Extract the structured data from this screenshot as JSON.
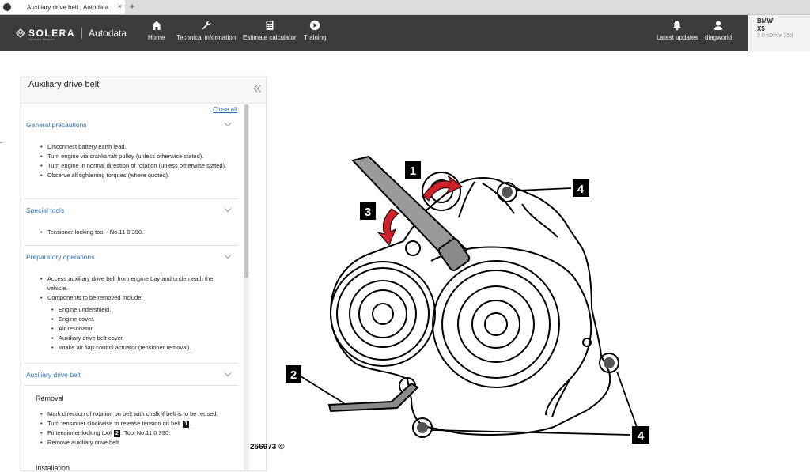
{
  "browser": {
    "tab_title": "Auxiliary drive belt | Autodata",
    "close_glyph": "×",
    "new_tab_glyph": "+"
  },
  "nav": {
    "brand": "SOLERA",
    "brand_sub": "Vehicle Repair",
    "product": "Autodata",
    "items": [
      {
        "label": "Home",
        "icon": "home-icon"
      },
      {
        "label": "Technical information",
        "icon": "wrench-icon"
      },
      {
        "label": "Estimate calculator",
        "icon": "calculator-icon"
      },
      {
        "label": "Training",
        "icon": "play-icon"
      },
      {
        "label": "Latest updates",
        "icon": "bell-icon"
      },
      {
        "label": "diagworld",
        "icon": "user-icon"
      }
    ]
  },
  "vehicle": {
    "make": "BMW",
    "model": "X5",
    "variant": "2.0 xDrive 25d"
  },
  "panel": {
    "title": "Auxiliary drive belt",
    "close_all": "Close all",
    "sections": [
      {
        "title": "General precautions",
        "items": [
          "Disconnect battery earth lead.",
          "Turn engine via crankshaft pulley (unless otherwise stated).",
          "Turn engine in normal direction of rotation (unless otherwise stated).",
          "Observe all tightening torques (where quoted)."
        ]
      },
      {
        "title": "Special tools",
        "items": [
          "Tensioner locking tool - No.11 0 390."
        ]
      },
      {
        "title": "Preparatory operations",
        "items": [
          "Access auxiliary drive belt from engine bay and underneath the vehicle.",
          "Components to be removed include:"
        ],
        "subitems": [
          "Engine undershield.",
          "Engine cover.",
          "Air resonator.",
          "Auxiliary drive belt cover.",
          "Intake air flap control actuator (tensioner removal)."
        ]
      },
      {
        "title": "Auxiliary drive belt"
      }
    ],
    "removal": {
      "heading": "Removal",
      "step1": "Mark direction of rotation on belt with chalk if belt is to be reused.",
      "step2_pre": "Turn tensioner clockwise to release tension on belt",
      "step2_badge": "1",
      "step2_post": ".",
      "step3_pre": "Fit tensioner locking tool",
      "step3_badge": "2",
      "step3_post": ". Tool No.11 0 390.",
      "step4": "Remove auxiliary drive belt."
    },
    "installation_heading": "Installation"
  },
  "diagram": {
    "callouts": [
      "1",
      "2",
      "3",
      "4",
      "4"
    ],
    "ref": "266973 ©"
  }
}
